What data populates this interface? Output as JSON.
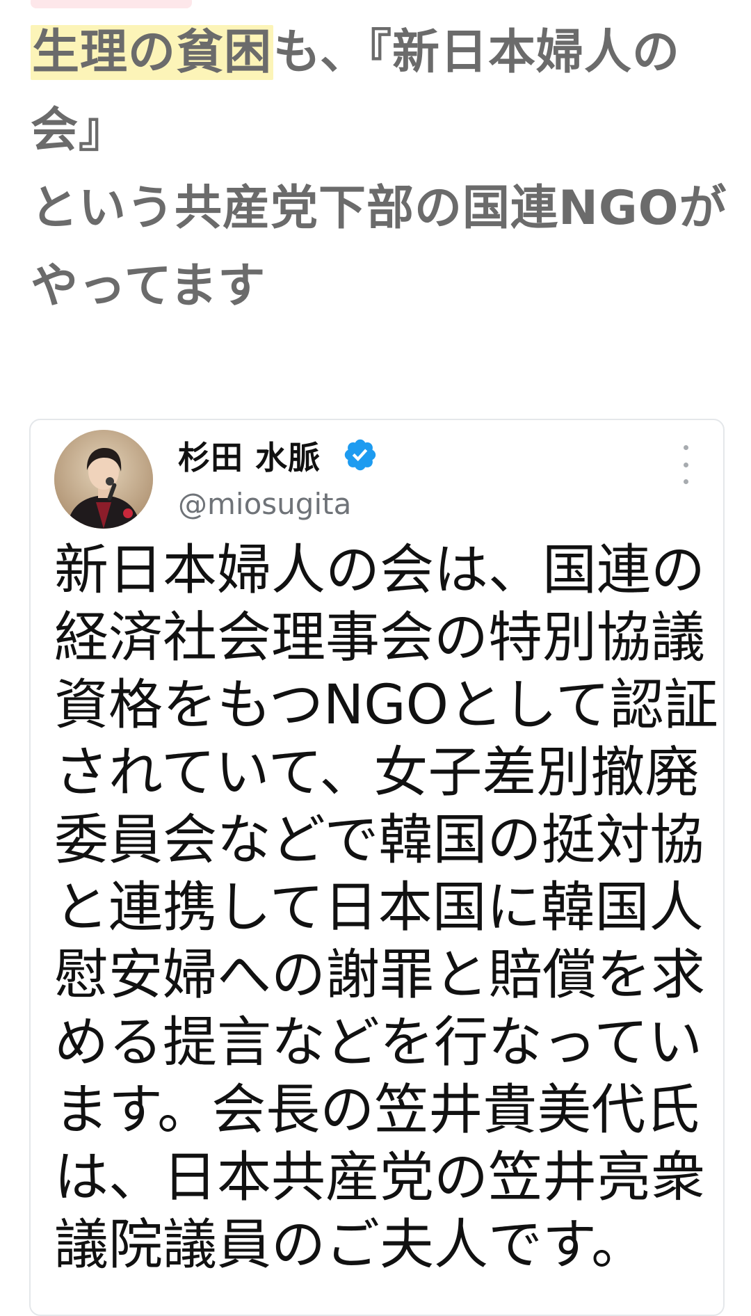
{
  "post": {
    "highlight": "生理の貧困",
    "lines": [
      "も、『新日本婦人の",
      "会』",
      "という共産党下部の国連NGOが",
      "やってます"
    ]
  },
  "quoted_tweet": {
    "author_name": "杉田 水脈",
    "handle": "@miosugita",
    "verified": true,
    "body_lines": [
      "新日本婦人の会は、国連の",
      "経済社会理事会の特別協議",
      "資格をもつNGOとして認証",
      "されていて、女子差別撤廃",
      "委員会などで韓国の挺対協",
      "と連携して日本国に韓国人",
      "慰安婦への謝罪と賠償を求",
      "める提言などを行なってい",
      "ます。会長の笠井貴美代氏",
      "は、日本共産党の笠井亮衆",
      "議院議員のご夫人です。"
    ]
  },
  "colors": {
    "highlight": "#fcf4b8",
    "post_text": "#6b6b6b",
    "verified_badge": "#1d9bf0",
    "handle": "#6f7378"
  },
  "icons": {
    "verified": "verified-badge-icon",
    "more": "more-vertical-icon"
  }
}
